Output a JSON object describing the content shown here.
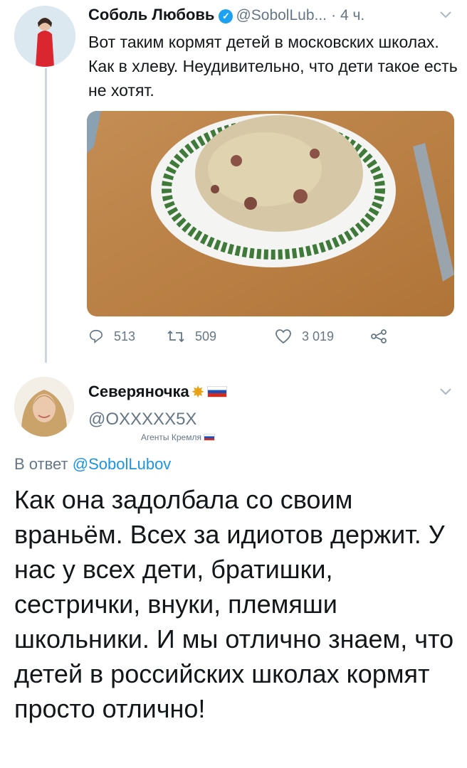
{
  "tweet1": {
    "name": "Соболь Любовь",
    "handle": "@SobolLub...",
    "time": "· 4 ч.",
    "text": "Вот таким кормят детей в московских школах. Как в хлеву. Неудивительно, что дети такое есть не хотят.",
    "stats": {
      "replies": "513",
      "retweets": "509",
      "likes": "3 019"
    }
  },
  "tweet2": {
    "name": "Северяночка",
    "handle": "@OXXXXX5X",
    "agents_label": "Агенты Кремля",
    "reply_prefix": "В ответ",
    "reply_to": "@SobolLubov",
    "text": "Как она задолбала со своим враньём. Всех за идиотов держит. У нас у всех дети, братишки, сестрички, внуки, племяши школьники. И мы отлично знаем, что детей в российских школах кормят просто отлично!"
  },
  "icons": [
    "verified-icon",
    "chevron-down-icon",
    "reply-icon",
    "retweet-icon",
    "like-icon",
    "share-icon",
    "explosion-icon",
    "russia-flag-icon"
  ],
  "colors": {
    "link": "#1b95e0",
    "muted": "#657786",
    "verified": "#1da1f2",
    "thread_line": "#ccd6dd"
  }
}
